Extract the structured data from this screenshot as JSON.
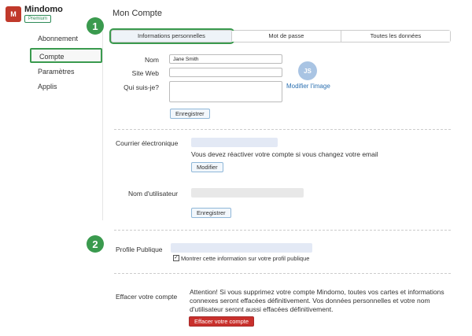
{
  "app": {
    "logo_text": "M",
    "brand": "Mindomo",
    "plan_badge": "Premium"
  },
  "page_title": "Mon Compte",
  "sidebar": {
    "items": [
      {
        "label": "Abonnement"
      },
      {
        "label": "Compte"
      },
      {
        "label": "Paramètres"
      },
      {
        "label": "Applis"
      }
    ]
  },
  "tabs": [
    {
      "label": "Informations personnelles"
    },
    {
      "label": "Mot de passe"
    },
    {
      "label": "Toutes les données"
    }
  ],
  "steps": [
    "1",
    "2"
  ],
  "profile": {
    "name_label": "Nom",
    "name_value": "Jane Smith",
    "website_label": "Site Web",
    "about_label": "Qui suis-je?",
    "avatar_initials": "JS",
    "change_image_link": "Modifier l'image",
    "save_button": "Enregistrer"
  },
  "email": {
    "label": "Courrier électronique",
    "note": "Vous devez réactiver votre compte si vous changez votre email",
    "modify_button": "Modifier"
  },
  "username": {
    "label": "Nom d'utilisateur",
    "save_button": "Enregistrer"
  },
  "public_profile": {
    "label": "Profile Publique",
    "checkbox_label": "Montrer cette information sur votre profil publique",
    "checkbox_mark": "✓"
  },
  "delete_account": {
    "label": "Effacer votre compte",
    "warning": "Attention! Si vous supprimez votre compte Mindomo, toutes vos cartes et informations connexes seront effacées définitivement. Vos données personnelles et votre nom d'utilisateur seront aussi effacées définitivement.",
    "button": "Effacer votre compte"
  },
  "colors": {
    "highlight_green": "#3a9a4e",
    "danger_red": "#c9302c",
    "link_blue": "#2a6fb0"
  }
}
